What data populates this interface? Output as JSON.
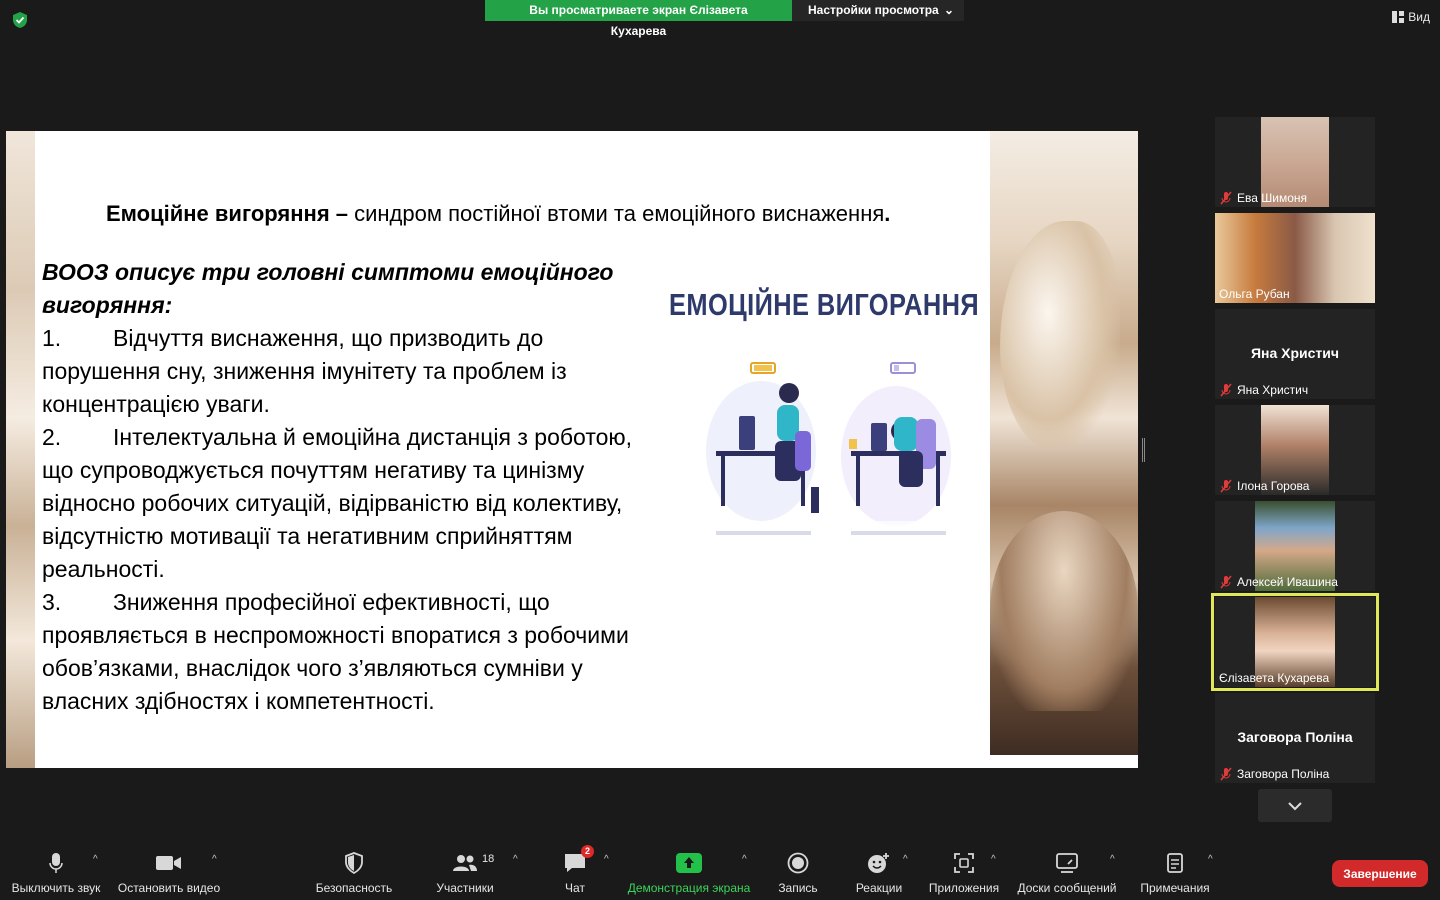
{
  "top": {
    "share_banner": "Вы просматриваете экран Єлізавета Кухарева",
    "view_options": "Настройки просмотра",
    "view_button": "Вид"
  },
  "slide": {
    "title_bold": "Емоційне вигоряння –",
    "title_rest": " синдром постійної втоми та емоційного виснаження",
    "title_end": ".",
    "intro": "ВООЗ описує три головні симптоми емоційного вигоряння:",
    "items": [
      {
        "num": "1.",
        "text": "Відчуття виснаження, що призводить до порушення сну, зниження імунітету та проблем із концентрацією уваги."
      },
      {
        "num": "2.",
        "text": "Інтелектуальна й емоційна дистанція з роботою, що супроводжується почуттям негативу та цинізму відносно робочих ситуацій, відірваністю від колективу, відсутністю мотивації та негативним сприйняттям реальності."
      },
      {
        "num": "3.",
        "text": "Зниження професійної ефективності, що проявляється в неспроможності впоратися з робочими обов’язками, внаслідок чого з’являються сумніви у власних здібностях і компетентності."
      }
    ],
    "poster_title": "ЕМОЦІЙНЕ ВИГОРАННЯ"
  },
  "participants": [
    {
      "name": "Ева Шимоня",
      "video": true,
      "muted": true
    },
    {
      "name": "Ольга Рубан",
      "video": true,
      "muted": false
    },
    {
      "name": "Яна Христич",
      "display": "Яна Христич",
      "video": false,
      "muted": true
    },
    {
      "name": "Ілона Горова",
      "video": true,
      "muted": true
    },
    {
      "name": "Алексей Ивашина",
      "video": true,
      "muted": true
    },
    {
      "name": "Єлізавета Кухарева",
      "video": true,
      "muted": false,
      "active": true
    },
    {
      "name": "Заговора Поліна",
      "display": "Заговора Поліна",
      "video": false,
      "muted": true
    }
  ],
  "toolbar": {
    "mute": "Выключить звук",
    "stop_video": "Остановить видео",
    "security": "Безопасность",
    "participants": "Участники",
    "participants_count": "18",
    "chat": "Чат",
    "chat_badge": "2",
    "share": "Демонстрация экрана",
    "record": "Запись",
    "reactions": "Реакции",
    "apps": "Приложения",
    "whiteboards": "Доски сообщений",
    "notes": "Примечания",
    "end": "Завершение"
  },
  "colors": {
    "share_green": "#23a247",
    "end_red": "#d22a2a",
    "active_outline": "#e0e85a",
    "poster_navy": "#2d3a6b"
  }
}
